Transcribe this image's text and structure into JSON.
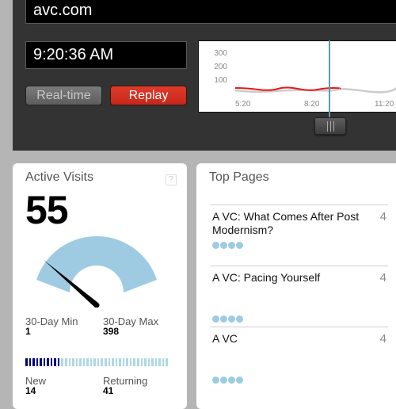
{
  "header": {
    "site": "avc.com",
    "time": "9:20:36 AM",
    "buttons": {
      "realtime": "Real-time",
      "replay": "Replay"
    }
  },
  "timeline": {
    "y_ticks": [
      "300",
      "200",
      "100"
    ],
    "x_ticks": [
      "5:20",
      "8:20",
      "11:20"
    ],
    "playhead_time": "9:20",
    "colors": {
      "played": "#e8181b",
      "future": "#cccccc",
      "playhead": "#5a9bb4"
    }
  },
  "active_visits": {
    "title": "Active Visits",
    "help": "?",
    "count": "55",
    "gauge": {
      "value": 55,
      "min": 1,
      "max": 398
    },
    "min_label": "30-Day Min",
    "min_value": "1",
    "max_label": "30-Day Max",
    "max_value": "398",
    "new_label": "New",
    "new_value": "14",
    "returning_label": "Returning",
    "returning_value": "41",
    "ratio": {
      "new": 14,
      "returning": 41
    },
    "colors": {
      "gauge": "#9ecbe2",
      "new": "#000080",
      "returning": "#add8e6"
    }
  },
  "top_pages": {
    "title": "Top Pages",
    "items": [
      {
        "title": "A VC: What Comes After Post Modernism?",
        "count": "4",
        "dots": 4
      },
      {
        "title": "A VC: Pacing Yourself",
        "count": "4",
        "dots": 4
      },
      {
        "title": "A VC",
        "count": "4",
        "dots": 4
      }
    ]
  }
}
